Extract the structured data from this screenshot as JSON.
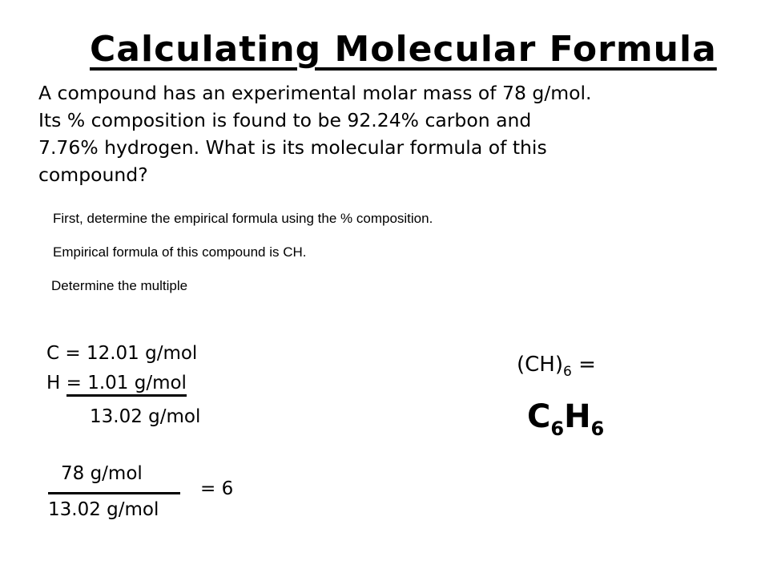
{
  "title": "Calculating Molecular Formula",
  "problem": {
    "lines": [
      "A compound has an experimental molar mass of 78 g/mol.",
      "Its % composition is found to be 92.24% carbon and",
      "7.76% hydrogen.  What is its molecular formula of this",
      "compound?"
    ]
  },
  "steps": {
    "step1": "First, determine the empirical formula using the % composition.",
    "step2": "Empirical formula of this compound is CH.",
    "step3": "Determine the multiple"
  },
  "masses": {
    "c_label": "C = 12.01 g/mol",
    "h_prefix": "H ",
    "h_underlined": "=  1.01 g/mol",
    "total": "13.02 g/mol"
  },
  "fraction": {
    "numerator": "78 g/mol",
    "denominator": "13.02 g/mol",
    "result": "= 6"
  },
  "formula": {
    "ch_base": "(CH)",
    "ch_sub": "6",
    "ch_eq": " =",
    "answer_c": "C",
    "answer_c_sub": "6",
    "answer_h": "H",
    "answer_h_sub": "6"
  }
}
